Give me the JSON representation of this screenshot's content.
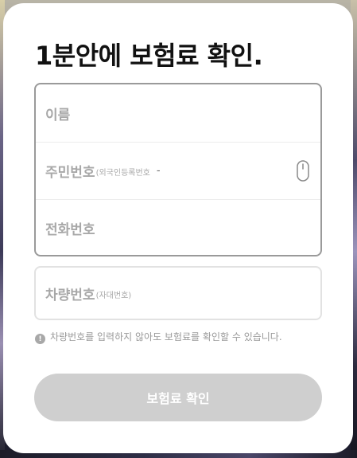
{
  "headline": "1분안에 보험료 확인.",
  "form": {
    "name_label": "이름",
    "resident_label": "주민번호",
    "resident_sub": "(외국인등록번호",
    "resident_separator": "-",
    "phone_label": "전화번호"
  },
  "vehicle": {
    "label": "차량번호",
    "sub": "(자대번호)"
  },
  "notice": {
    "icon_glyph": "!",
    "text": "차량번호를 입력하지 않아도 보험료를 확인할 수 있습니다."
  },
  "confirm_button_label": "보험료 확인",
  "icons": [
    "mouse-icon",
    "info-icon"
  ],
  "colors": {
    "button_disabled": "#cfcfcf",
    "placeholder": "#a8a8a8",
    "form_border": "#9a9a9a"
  }
}
